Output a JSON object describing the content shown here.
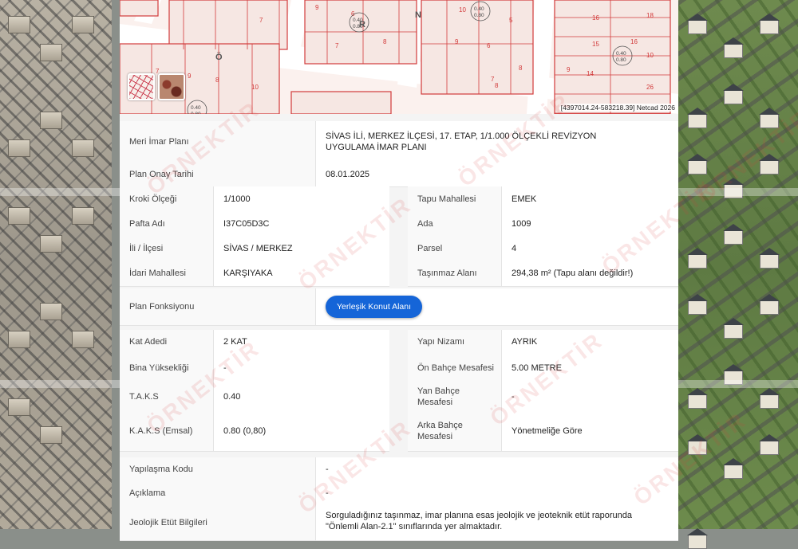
{
  "map": {
    "coords": "[4397014.24-583218.39] Netcad 2026",
    "street_letters": [
      "R",
      "N",
      "Ö"
    ],
    "parcels": [
      "7",
      "9",
      "8",
      "10",
      "7",
      "9",
      "6",
      "8",
      "7",
      "10",
      "5",
      "9",
      "6",
      "8",
      "7",
      "16",
      "18",
      "15",
      "14",
      "26",
      "16",
      "10",
      "9",
      "8"
    ],
    "taks_badges": [
      "0.40\n0.80",
      "0.40\n0.80",
      "0.40\n0.80",
      "0.40\n0.80"
    ],
    "layers": [
      {
        "name": "plan-layer",
        "icon": "plan-layer-icon"
      },
      {
        "name": "satellite-layer",
        "icon": "satellite-layer-icon"
      }
    ]
  },
  "info": {
    "meri_imar_label": "Meri İmar Planı",
    "meri_imar_value": "SİVAS İLİ, MERKEZ İLÇESİ, 17. ETAP, 1/1.000 ÖLÇEKLİ REVİZYON UYGULAMA İMAR PLANI",
    "plan_onay_label": "Plan Onay Tarihi",
    "plan_onay_value": "08.01.2025",
    "left_block": [
      {
        "label": "Kroki Ölçeği",
        "value": "1/1000"
      },
      {
        "label": "Pafta Adı",
        "value": "I37C05D3C"
      },
      {
        "label": "İli / İlçesi",
        "value": "SİVAS / MERKEZ"
      },
      {
        "label": "İdari Mahallesi",
        "value": "KARŞIYAKA"
      }
    ],
    "right_block": [
      {
        "label": "Tapu Mahallesi",
        "value": "EMEK"
      },
      {
        "label": "Ada",
        "value": "1009"
      },
      {
        "label": "Parsel",
        "value": "4"
      },
      {
        "label": "Taşınmaz Alanı",
        "value": "294,38 m² (Tapu alanı değildir!)"
      }
    ],
    "plan_fonksiyonu_label": "Plan Fonksiyonu",
    "plan_fonksiyonu_value": "Yerleşik Konut Alanı",
    "left_block2": [
      {
        "label": "Kat Adedi",
        "value": "2 KAT"
      },
      {
        "label": "Bina Yüksekliği",
        "value": "-"
      },
      {
        "label": "T.A.K.S",
        "value": "0.40"
      },
      {
        "label": "K.A.K.S (Emsal)",
        "value": "0.80 (0,80)"
      }
    ],
    "right_block2": [
      {
        "label": "Yapı Nizamı",
        "value": "AYRIK"
      },
      {
        "label": "Ön Bahçe Mesafesi",
        "value": "5.00 METRE"
      },
      {
        "label": "Yan Bahçe Mesafesi",
        "value": "-"
      },
      {
        "label": "Arka Bahçe Mesafesi",
        "value": "Yönetmeliğe Göre"
      }
    ],
    "yapilasma_label": "Yapılaşma Kodu",
    "yapilasma_value": "-",
    "aciklama_label": "Açıklama",
    "aciklama_value": "-",
    "jeolojik_label": "Jeolojik Etüt Bilgileri",
    "jeolojik_value": "Sorguladığınız taşınmaz, imar planına esas jeolojik ve jeoteknik etüt raporunda \"Önlemli Alan-2.1\" sınıflarında yer almaktadır."
  },
  "watermark": "ÖRNEKTİR",
  "colors": {
    "accent": "#1565d8",
    "parcel_line": "#d23b3b",
    "map_bg": "#fbf1ee"
  }
}
